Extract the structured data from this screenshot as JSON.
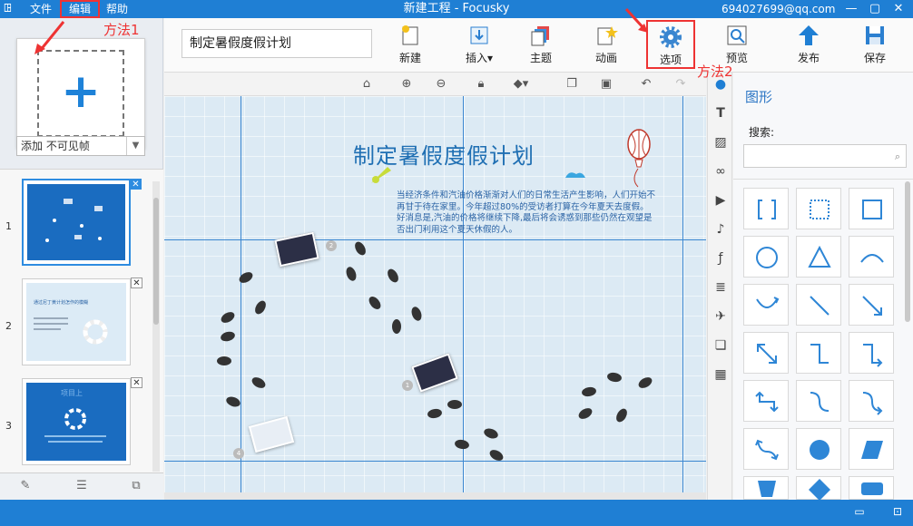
{
  "titlebar": {
    "logo": "ꖸ",
    "menus": {
      "file": "文件",
      "edit": "编辑",
      "help": "帮助"
    },
    "title": "新建工程 - Focusky",
    "user": "694027699@qq.com",
    "minimize": "—",
    "maximize": "▢",
    "close": "✕"
  },
  "annotations": {
    "method1": "方法1",
    "method2": "方法2"
  },
  "left": {
    "add_plus": "+",
    "select_value": "添加 不可见帧",
    "select_arrow": "▼",
    "thumbs": [
      {
        "num": "1",
        "close": "✕"
      },
      {
        "num": "2",
        "close": "✕",
        "text": "通过尼丁黄计划怎作的模糊"
      },
      {
        "num": "3",
        "close": "✕",
        "text": "项目上"
      }
    ]
  },
  "toolbar": {
    "project_name": "制定暑假度假计划",
    "buttons": {
      "new": "新建",
      "insert": "插入",
      "theme": "主题",
      "animation": "动画",
      "options": "选项",
      "preview": "预览",
      "publish": "发布",
      "save": "保存"
    }
  },
  "canvas": {
    "title": "制定暑假度假计划",
    "body": "当经济条件和汽油价格渐渐对人们的日常生活产生影响，人们开始不再甘于待在家里。今年超过80%的受访者打算在今年夏天去度假。 好消息是,汽油的价格将继续下降,最后将会诱惑到那些仍然在观望是否出门利用这个夏天休假的人。",
    "ring_labels": [
      "2",
      "1",
      "4"
    ]
  },
  "rpanel": {
    "title": "图形",
    "search_label": "搜索:",
    "search_icon": "⌕"
  },
  "colors": {
    "titlebar": "#1f7fd4",
    "accent": "#2e8ce0",
    "annotation": "#e33333"
  }
}
